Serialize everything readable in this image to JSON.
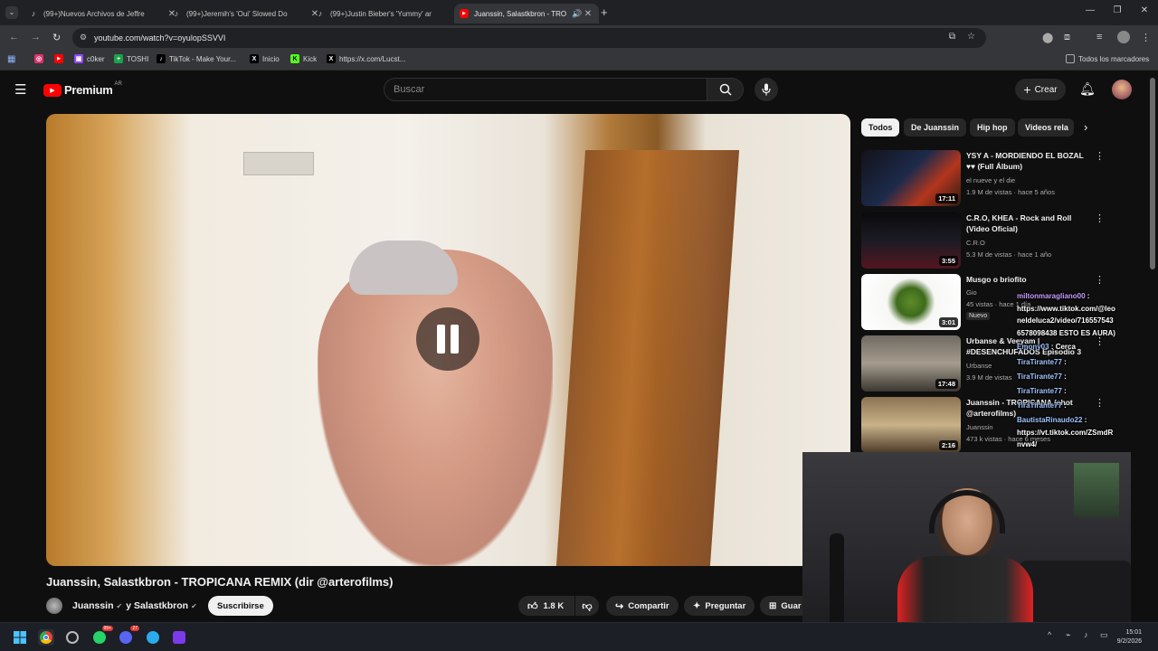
{
  "browser": {
    "tabs": [
      {
        "title": "(99+)Nuevos Archivos de Jeffre",
        "icon": "tiktok-icon",
        "active": false
      },
      {
        "title": "(99+)Jeremih's 'Oui' Slowed Do",
        "icon": "tiktok-icon",
        "active": false
      },
      {
        "title": "(99+)Justin Bieber's 'Yummy' ar",
        "icon": "tiktok-icon",
        "active": false
      },
      {
        "title": "Juanssin, Salastkbron - TRO",
        "icon": "youtube-icon",
        "active": true
      }
    ],
    "url": "youtube.com/watch?v=oyulopSSVVI",
    "bookmarks": [
      {
        "label": "",
        "icon": "instagram-icon",
        "color": "#e1306c"
      },
      {
        "label": "",
        "icon": "youtube-icon",
        "color": "#ff0000"
      },
      {
        "label": "c0ker",
        "icon": "twitch-icon",
        "color": "#9146ff"
      },
      {
        "label": "TOSHI",
        "icon": "plus-icon",
        "color": "#1aa34a"
      },
      {
        "label": "TikTok - Make Your...",
        "icon": "tiktok-icon",
        "color": "#000000"
      },
      {
        "label": "Inicio",
        "icon": "x-icon",
        "color": "#000000"
      },
      {
        "label": "Kick",
        "icon": "kick-icon",
        "color": "#53fc18"
      },
      {
        "label": "https://x.com/Lucst...",
        "icon": "x-icon",
        "color": "#000000"
      }
    ],
    "all_bookmarks_label": "Todos los marcadores"
  },
  "youtube": {
    "logo_text": "Premium",
    "region": "AR",
    "search_placeholder": "Buscar",
    "create_label": "Crear",
    "video_title": "Juanssin, Salastkbron - TROPICANA REMIX (dir @arterofilms)",
    "channel_text": "Juanssin",
    "channel_and": "y Salastkbron",
    "subscribe_label": "Suscribirse",
    "likes": "1.8 K",
    "share_label": "Compartir",
    "ask_label": "Preguntar",
    "save_label": "Guar",
    "chips": [
      "Todos",
      "De Juanssin",
      "Hip hop",
      "Videos rela"
    ],
    "recommendations": [
      {
        "title": "YSY A - MORDIENDO EL BOZAL ♥♥ (Full Álbum)",
        "channel": "el nueve y el die",
        "meta": "1.9 M de vistas · hace 5 años",
        "duration": "17:11",
        "badge": ""
      },
      {
        "title": "C.R.O, KHEA - Rock and Roll (Video Oficial)",
        "channel": "C.R.O",
        "meta": "5.3 M de vistas · hace 1 año",
        "duration": "3:55",
        "badge": ""
      },
      {
        "title": "Musgo o briofito",
        "channel": "Gio",
        "meta": "45 vistas · hace 1 día",
        "duration": "3:01",
        "badge": "Nuevo"
      },
      {
        "title": "Urbanse & Veeyam | #DESENCHUFADOS Episodio 3",
        "channel": "Urbanse",
        "meta": "3.9 M de vistas",
        "duration": "17:48",
        "badge": ""
      },
      {
        "title": "Juanssin - TROPICANA (shot @arterofilms)",
        "channel": "Juanssin",
        "meta": "473 k vistas · hace 6 meses",
        "duration": "2:16",
        "badge": ""
      }
    ]
  },
  "chat": [
    {
      "user": "miltonmaragliano00",
      "text": "https://www.tiktok.com/@leo"
    },
    {
      "user": "",
      "text": "neldeluca2/video/716557543"
    },
    {
      "user": "",
      "text": "6578098438 ESTO ES AURA)"
    },
    {
      "user": "Emony03",
      "text": "Cerca"
    },
    {
      "user": "TiraTirante77",
      "text": ""
    },
    {
      "user": "TiraTirante77",
      "text": ""
    },
    {
      "user": "TiraTirante77",
      "text": ""
    },
    {
      "user": "TiraTirante77",
      "text": ""
    },
    {
      "user": "BautistaRinaudo22",
      "text": ""
    },
    {
      "user": "",
      "text": "https://vt.tiktok.com/ZSmdR"
    },
    {
      "user": "",
      "text": "nvw4/"
    }
  ],
  "taskbar": {
    "time": "15:01",
    "date": "9/2/2026",
    "badges": {
      "whatsapp": "99+",
      "messenger": "27"
    }
  }
}
